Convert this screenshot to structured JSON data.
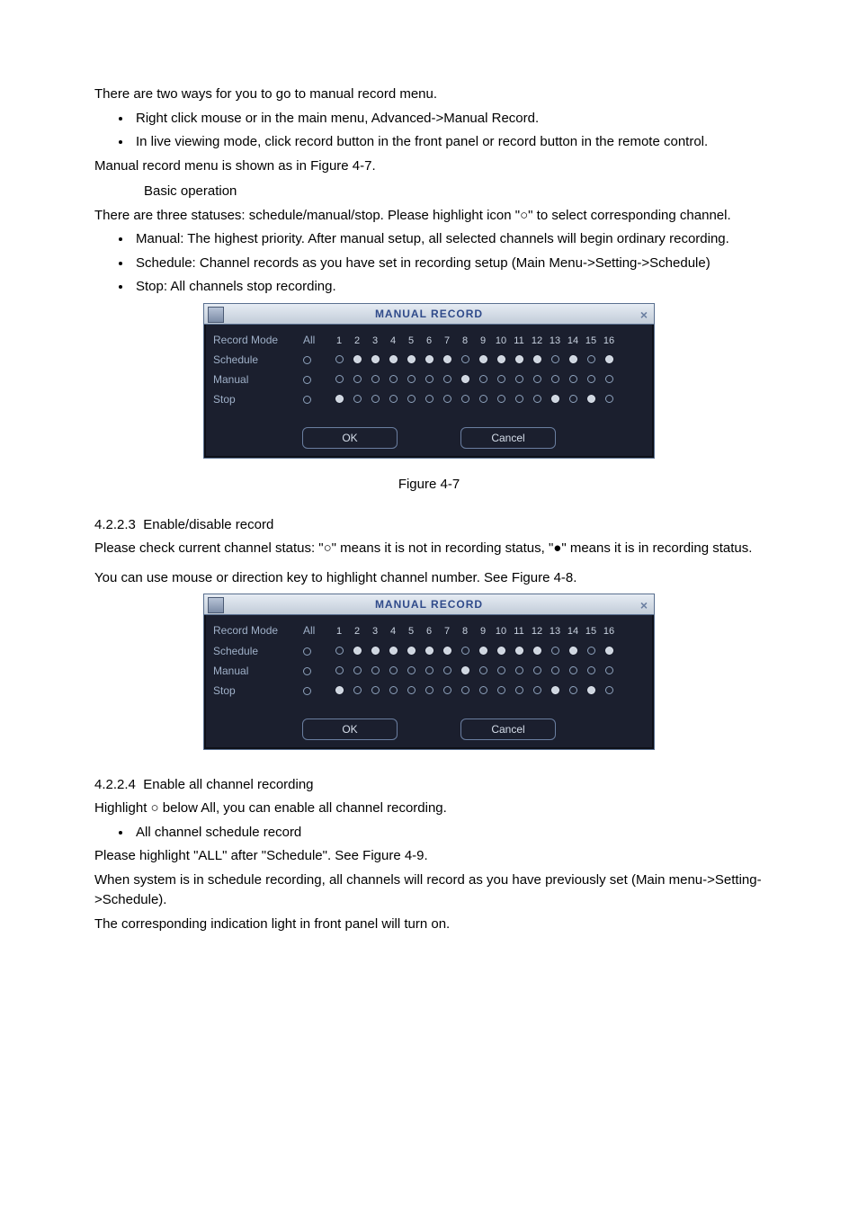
{
  "intro_line": "There are two ways for you to go to manual record menu.",
  "intro_bullets": [
    "Right click mouse or in the main menu, Advanced->Manual Record.",
    "In live viewing mode, click record button in the front panel or record button in the remote control."
  ],
  "menu_shown_line": "Manual record menu is shown as in Figure 4-7.",
  "basic_op_heading": "Basic operation",
  "basic_op_intro": "There are three statuses: schedule/manual/stop. Please highlight icon \"○\" to select corresponding channel.",
  "basic_op_bullets": [
    "Manual: The highest priority. After manual setup, all selected channels will begin ordinary recording.",
    "Schedule: Channel records as you have set in recording setup (Main Menu->Setting->Schedule)",
    "Stop: All channels stop recording."
  ],
  "manual_record_dialog": {
    "title": "MANUAL RECORD",
    "close": "×",
    "header_label": "Record Mode",
    "all_label": "All",
    "channel_count": 16,
    "ok": "OK",
    "cancel": "Cancel",
    "rows": [
      {
        "name": "Schedule",
        "all": "open",
        "channels": [
          "open",
          "filled",
          "filled",
          "filled",
          "filled",
          "filled",
          "filled",
          "open",
          "filled",
          "filled",
          "filled",
          "filled",
          "open",
          "filled",
          "open",
          "filled"
        ]
      },
      {
        "name": "Manual",
        "all": "open",
        "channels": [
          "open",
          "open",
          "open",
          "open",
          "open",
          "open",
          "open",
          "filled",
          "open",
          "open",
          "open",
          "open",
          "open",
          "open",
          "open",
          "open"
        ]
      },
      {
        "name": "Stop",
        "all": "open",
        "channels": [
          "filled",
          "open",
          "open",
          "open",
          "open",
          "open",
          "open",
          "open",
          "open",
          "open",
          "open",
          "open",
          "filled",
          "open",
          "filled",
          "open"
        ]
      }
    ]
  },
  "fig47_caption": "Figure 4-7",
  "sec4223_num": "4.2.2.3",
  "sec4223_title": "Enable/disable record",
  "sec4223_p1": "Please check current channel status: \"○\" means it is not in recording status, \"●\" means it is in recording status.",
  "sec4223_p2": "You can use mouse or direction key to highlight channel number. See Figure 4-8.",
  "sec4224_num": "4.2.2.4",
  "sec4224_title": "Enable all channel recording",
  "sec4224_p1": "Highlight ○ below All, you can enable all channel recording.",
  "sec4224_bullets": [
    "All channel schedule record"
  ],
  "sec4224_p2": "Please highlight \"ALL\" after \"Schedule\". See Figure 4-9.",
  "sec4224_p3": "When system is in schedule recording, all channels will record as you have previously set (Main menu->Setting->Schedule).",
  "sec4224_p4": "The corresponding indication light in front panel will turn on."
}
